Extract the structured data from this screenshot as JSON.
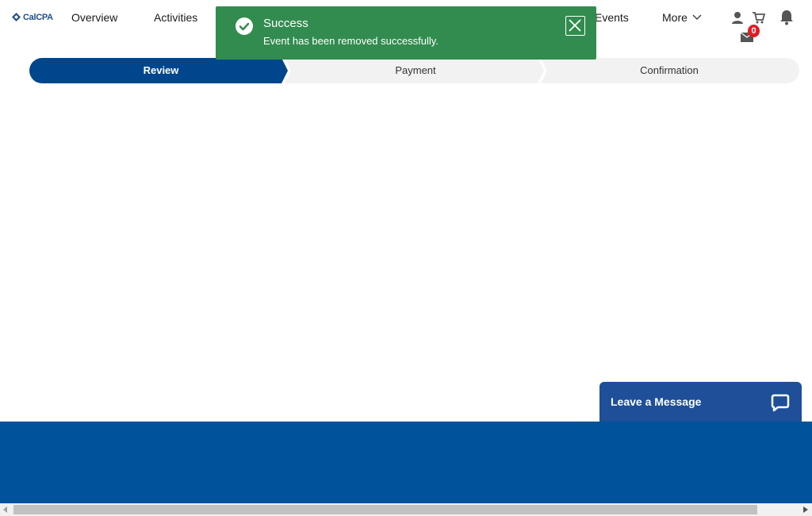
{
  "brand": {
    "logo_text": "CalCPA"
  },
  "nav": {
    "items": [
      "Overview",
      "Activities",
      "Events"
    ],
    "more_label": "More"
  },
  "header_icons": {
    "profile": "user-icon",
    "cart": "cart-icon",
    "notifications": "bell-icon",
    "mail": "mail-icon",
    "mail_count": "0"
  },
  "toast": {
    "title": "Success",
    "message": "Event has been removed successfully.",
    "status_icon": "check-circle-icon",
    "close_icon": "close-icon",
    "color": "#328c4f"
  },
  "stepper": {
    "steps": [
      "Review",
      "Payment",
      "Confirmation"
    ],
    "active_index": 0,
    "active_color": "#00468c",
    "inactive_color": "#f2f2f2"
  },
  "chat": {
    "label": "Leave a Message",
    "icon": "chat-bubble-icon"
  },
  "colors": {
    "footer": "#00529b",
    "brand": "#1f4e8c"
  }
}
